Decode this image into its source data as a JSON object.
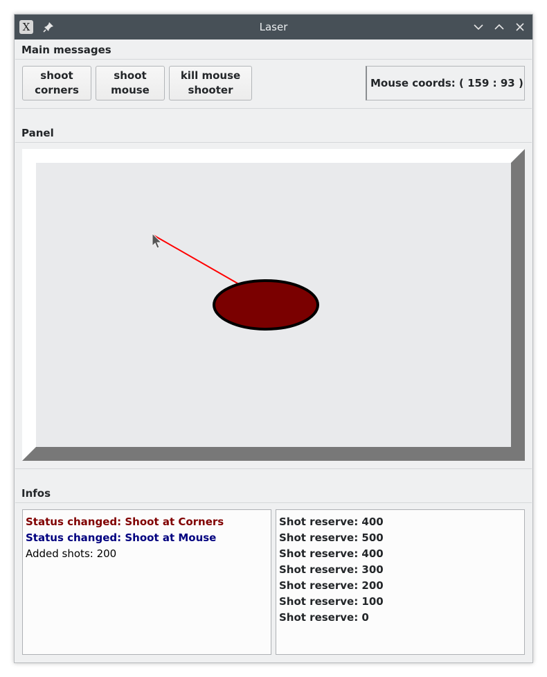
{
  "window": {
    "title": "Laser"
  },
  "titlebar": {
    "app_icon": "x-logo-icon",
    "pin_icon": "pin-icon",
    "buttons": [
      "chevron-down-icon",
      "chevron-up-icon",
      "close-icon"
    ]
  },
  "main_messages": {
    "title": "Main messages",
    "buttons": {
      "shoot_corners": "shoot\ncorners",
      "shoot_mouse": "shoot\nmouse",
      "kill_mouse_shooter": "kill mouse\nshooter"
    },
    "mouse_coords": "Mouse coords: ( 159 : 93 )"
  },
  "panel": {
    "title": "Panel",
    "colors": {
      "light_bevel": "#ffffff",
      "dark_bevel": "#787878",
      "canvas": "#e9eaec",
      "laser": "#ff0000",
      "target_fill": "#7a0000",
      "target_stroke": "#000000"
    }
  },
  "infos": {
    "title": "Infos",
    "messages": [
      {
        "text": "Status changed: Shoot at Corners",
        "color": "#800000",
        "bold": true
      },
      {
        "text": "Status changed: Shoot at Mouse",
        "color": "#00007f",
        "bold": true
      },
      {
        "text": "Added shots: 200",
        "color": "#000000",
        "bold": false
      }
    ],
    "reserves": [
      "Shot reserve: 400",
      "Shot reserve: 500",
      "Shot reserve: 400",
      "Shot reserve: 300",
      "Shot reserve: 200",
      "Shot reserve: 100",
      "Shot reserve: 0"
    ]
  }
}
